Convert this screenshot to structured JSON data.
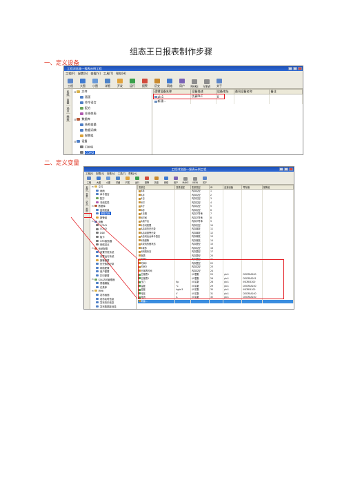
{
  "doc": {
    "title": "组态王日报表制作步骤",
    "sec1": "一、定义设备",
    "sec2": "二、定义变量"
  },
  "shot1": {
    "window_title": "工程浏览器---报表示例工程",
    "menus": [
      "工程[F]",
      "配置[S]",
      "查看[V]",
      "工具[T]",
      "帮助[H]"
    ],
    "toolbar": [
      "工程",
      "大图",
      "小图",
      "详细",
      "开发",
      "运行",
      "报警",
      "历史",
      "网络",
      "用户",
      "MAKE",
      "VIEW",
      "关于"
    ],
    "side_tabs": [
      "系统",
      "变量",
      "站点",
      "画面"
    ],
    "tree": [
      {
        "t": "文件",
        "lvl": 0,
        "c": "#d9b24a"
      },
      {
        "t": "画面",
        "lvl": 1,
        "c": "#4f7fc6"
      },
      {
        "t": "命令语言",
        "lvl": 1,
        "c": "#4f7fc6"
      },
      {
        "t": "配方",
        "lvl": 1,
        "c": "#6ba35b"
      },
      {
        "t": "非线性表",
        "lvl": 1,
        "c": "#b05bb0"
      },
      {
        "t": "数据库",
        "lvl": 0,
        "c": "#b85a3a"
      },
      {
        "t": "结构变量",
        "lvl": 1,
        "c": "#4f7fc6"
      },
      {
        "t": "数据词典",
        "lvl": 1,
        "c": "#4f7fc6"
      },
      {
        "t": "报警组",
        "lvl": 1,
        "c": "#d9a23a"
      },
      {
        "t": "设备",
        "lvl": 0,
        "c": "#4f7fc6"
      },
      {
        "t": "COM1",
        "lvl": 1,
        "c": "#777777"
      },
      {
        "t": "COM2",
        "lvl": 1,
        "c": "#777777",
        "sel": true
      },
      {
        "t": "DDE",
        "lvl": 1,
        "c": "#777777"
      }
    ],
    "cols": [
      "逻辑设备名称",
      "设备描述",
      "设备地址",
      "通讯设备名称",
      "备注"
    ],
    "rows": [
      {
        "name": "plc1",
        "desc": "仿真PLC",
        "addr": "0",
        "comm": "",
        "note": ""
      },
      {
        "name": "新建...",
        "desc": "",
        "addr": "",
        "comm": "",
        "note": ""
      }
    ]
  },
  "shot2": {
    "window_title": "工程浏览器---报表示例工程",
    "menus": [
      "工程[F]",
      "配置[S]",
      "查看[V]",
      "工具[T]",
      "帮助[H]"
    ],
    "toolbar": [
      "工程",
      "大图",
      "小图",
      "详细",
      "开发",
      "运行",
      "报警",
      "历史",
      "网络",
      "用户",
      "MAKE",
      "VIEW",
      "关于"
    ],
    "side_tabs": [
      "系统",
      "变量",
      "站点",
      "画面"
    ],
    "tree": [
      {
        "t": "文件",
        "lvl": 0,
        "c": "#d9b24a"
      },
      {
        "t": "画面",
        "lvl": 1,
        "c": "#4f7fc6"
      },
      {
        "t": "命令语言",
        "lvl": 1,
        "c": "#4f7fc6"
      },
      {
        "t": "配方",
        "lvl": 1,
        "c": "#6ba35b"
      },
      {
        "t": "非线性表",
        "lvl": 1,
        "c": "#b05bb0"
      },
      {
        "t": "数据库",
        "lvl": 0,
        "c": "#b85a3a"
      },
      {
        "t": "结构变量",
        "lvl": 1,
        "c": "#4f7fc6"
      },
      {
        "t": "数据词典",
        "lvl": 1,
        "c": "#4f7fc6",
        "sel": true
      },
      {
        "t": "报警组",
        "lvl": 1,
        "c": "#d9a23a"
      },
      {
        "t": "设备",
        "lvl": 0,
        "c": "#4f7fc6"
      },
      {
        "t": "COM1",
        "lvl": 1,
        "c": "#777777"
      },
      {
        "t": "COM2",
        "lvl": 1,
        "c": "#777777"
      },
      {
        "t": "DDE",
        "lvl": 1,
        "c": "#777777"
      },
      {
        "t": "板卡",
        "lvl": 1,
        "c": "#777777"
      },
      {
        "t": "OPC服务器",
        "lvl": 1,
        "c": "#777777"
      },
      {
        "t": "网络站点",
        "lvl": 1,
        "c": "#777777"
      },
      {
        "t": "系统配置",
        "lvl": 0,
        "c": "#b85a3a"
      },
      {
        "t": "设置开发系统",
        "lvl": 1,
        "c": "#4f7fc6"
      },
      {
        "t": "设置运行系统",
        "lvl": 1,
        "c": "#4f7fc6"
      },
      {
        "t": "报警配置",
        "lvl": 1,
        "c": "#d9a23a"
      },
      {
        "t": "历史数据记录",
        "lvl": 1,
        "c": "#4f7fc6"
      },
      {
        "t": "网络配置",
        "lvl": 1,
        "c": "#4f7fc6"
      },
      {
        "t": "用户配置",
        "lvl": 1,
        "c": "#4f7fc6"
      },
      {
        "t": "打印配置",
        "lvl": 1,
        "c": "#4f7fc6"
      },
      {
        "t": "SQL访问管理器",
        "lvl": 0,
        "c": "#6ba35b"
      },
      {
        "t": "表格模板",
        "lvl": 1,
        "c": "#4f7fc6"
      },
      {
        "t": "记录体",
        "lvl": 1,
        "c": "#4f7fc6"
      },
      {
        "t": "Web",
        "lvl": 0,
        "c": "#d9b24a"
      },
      {
        "t": "发布画面",
        "lvl": 1,
        "c": "#4f7fc6"
      },
      {
        "t": "发布实时信息",
        "lvl": 1,
        "c": "#4f7fc6"
      },
      {
        "t": "发布历史信息",
        "lvl": 1,
        "c": "#4f7fc6"
      },
      {
        "t": "发布数据库信息",
        "lvl": 1,
        "c": "#4f7fc6"
      }
    ],
    "cols": [
      "变量名",
      "变量描述",
      "变量类型",
      "ID",
      "连接设备",
      "寄存器",
      "报警组"
    ],
    "rows": [
      {
        "n": "$年",
        "d": "",
        "t": "内存实型",
        "id": "1",
        "dev": "",
        "reg": "",
        "sel": false
      },
      {
        "n": "$月",
        "d": "",
        "t": "内存实型",
        "id": "2",
        "dev": "",
        "reg": "",
        "sel": false
      },
      {
        "n": "$日",
        "d": "",
        "t": "内存实型",
        "id": "3",
        "dev": "",
        "reg": "",
        "sel": false
      },
      {
        "n": "$时",
        "d": "",
        "t": "内存实型",
        "id": "4",
        "dev": "",
        "reg": "",
        "sel": false
      },
      {
        "n": "$分",
        "d": "",
        "t": "内存实型",
        "id": "5",
        "dev": "",
        "reg": "",
        "sel": false
      },
      {
        "n": "$秒",
        "d": "",
        "t": "内存实型",
        "id": "6",
        "dev": "",
        "reg": "",
        "sel": false
      },
      {
        "n": "$日期",
        "d": "",
        "t": "内存字符串",
        "id": "7",
        "dev": "",
        "reg": "",
        "sel": false
      },
      {
        "n": "$时间",
        "d": "",
        "t": "内存字符串",
        "id": "8",
        "dev": "",
        "reg": "",
        "sel": false
      },
      {
        "n": "$用户名",
        "d": "",
        "t": "内存字符串",
        "id": "9",
        "dev": "",
        "reg": "",
        "sel": false
      },
      {
        "n": "$访问权限",
        "d": "",
        "t": "内存实型",
        "id": "10",
        "dev": "",
        "reg": "",
        "sel": false
      },
      {
        "n": "$启动历史记录",
        "d": "",
        "t": "内存离散",
        "id": "11",
        "dev": "",
        "reg": "",
        "sel": false
      },
      {
        "n": "$启动报警记录",
        "d": "",
        "t": "内存离散",
        "id": "12",
        "dev": "",
        "reg": "",
        "sel": false
      },
      {
        "n": "$启动后台命令语言",
        "d": "",
        "t": "内存离散",
        "id": "13",
        "dev": "",
        "reg": "",
        "sel": false
      },
      {
        "n": "$新报警",
        "d": "",
        "t": "内存离散",
        "id": "14",
        "dev": "",
        "reg": "",
        "sel": false
      },
      {
        "n": "$双机热备状态",
        "d": "",
        "t": "内存整型",
        "id": "15",
        "dev": "",
        "reg": "",
        "sel": false
      },
      {
        "n": "$毫秒",
        "d": "",
        "t": "内存实型",
        "id": "16",
        "dev": "",
        "reg": "",
        "sel": false
      },
      {
        "n": "$网络状态",
        "d": "",
        "t": "内存整型",
        "id": "17",
        "dev": "",
        "reg": "",
        "sel": false
      },
      {
        "n": "报表",
        "d": "",
        "t": "内存整型",
        "id": "20",
        "dev": "",
        "reg": "",
        "sel": false
      },
      {
        "n": "时间1",
        "d": "",
        "t": "内存整型",
        "id": "21",
        "dev": "",
        "reg": "",
        "sel": false
      },
      {
        "n": "时间2",
        "d": "",
        "t": "内存整型",
        "id": "22",
        "dev": "",
        "reg": "",
        "sel": false
      },
      {
        "n": "时间3",
        "d": "",
        "t": "内存实型",
        "id": "23",
        "dev": "",
        "reg": "",
        "sel": false
      },
      {
        "n": "日报表时间",
        "d": "",
        "t": "内存实型",
        "id": "24",
        "dev": "",
        "reg": "",
        "sel": false
      },
      {
        "n": "日报表1",
        "d": "",
        "t": "I/O整数",
        "id": "25",
        "dev": "plc1",
        "reg": "DECREA200",
        "sel": false
      },
      {
        "n": "日报表2",
        "d": "",
        "t": "I/O整数",
        "id": "26",
        "dev": "plc1",
        "reg": "DECREA201",
        "sel": false
      },
      {
        "n": "压力",
        "d": "Kp",
        "t": "I/O实数",
        "id": "28",
        "dev": "plc1",
        "reg": "INCREA300",
        "sel": false
      },
      {
        "n": "温度",
        "d": "℃",
        "t": "I/O实数",
        "id": "29",
        "dev": "plc1",
        "reg": "DECREA100",
        "sel": false
      },
      {
        "n": "密度",
        "d": "kg/m3",
        "t": "I/O实数",
        "id": "30",
        "dev": "plc1",
        "reg": "INCREA100",
        "sel": false
      },
      {
        "n": "电压",
        "d": "V",
        "t": "I/O实数",
        "id": "31",
        "dev": "plc1",
        "reg": "DECREA100",
        "sel": false
      },
      {
        "n": "电流",
        "d": "A",
        "t": "I/O实数",
        "id": "32",
        "dev": "plc1",
        "reg": "DECREA100",
        "sel": false
      },
      {
        "n": "新建...",
        "d": "",
        "t": "",
        "id": "",
        "dev": "",
        "reg": "",
        "sel": true
      }
    ]
  },
  "colors": {
    "accent_red": "#e31c23",
    "title_blue": "#1d4fb3",
    "select_blue": "#3a8de0"
  }
}
